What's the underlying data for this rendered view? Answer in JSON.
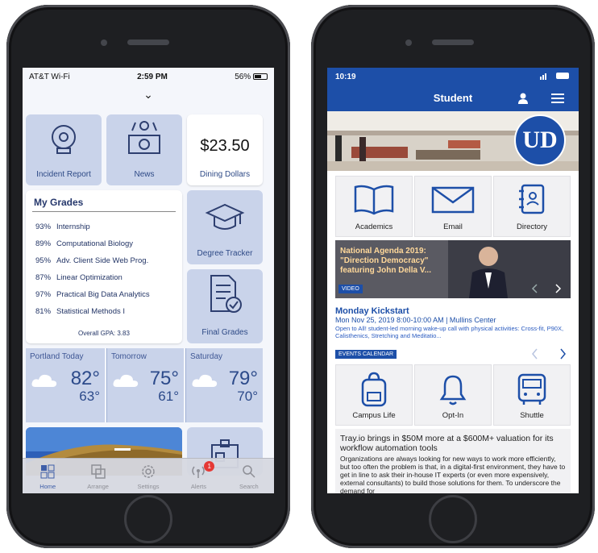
{
  "left_phone": {
    "status": {
      "carrier": "AT&T Wi-Fi",
      "time": "2:59 PM",
      "battery": "56%"
    },
    "pull_indicator": "⌄",
    "tiles": {
      "incident_report": "Incident Report",
      "news": "News",
      "dining_amount": "$23.50",
      "dining_label": "Dining Dollars",
      "degree_tracker": "Degree Tracker",
      "final_grades": "Final Grades"
    },
    "grades": {
      "title": "My Grades",
      "rows": [
        {
          "pct": "93%",
          "course": "Internship"
        },
        {
          "pct": "89%",
          "course": "Computational Biology"
        },
        {
          "pct": "95%",
          "course": "Adv. Client Side Web Prog."
        },
        {
          "pct": "87%",
          "course": "Linear Optimization"
        },
        {
          "pct": "97%",
          "course": "Practical Big Data Analytics"
        },
        {
          "pct": "81%",
          "course": "Statistical Methods I"
        }
      ],
      "gpa": "Overall GPA: 3.83"
    },
    "weather": [
      {
        "day": "Portland Today",
        "hi": "82°",
        "lo": "63°"
      },
      {
        "day": "Tomorrow",
        "hi": "75°",
        "lo": "61°"
      },
      {
        "day": "Saturday",
        "hi": "79°",
        "lo": "70°"
      }
    ],
    "tabbar": {
      "home": "Home",
      "arrange": "Arrange",
      "settings": "Settings",
      "alerts": "Alerts",
      "alerts_badge": "1",
      "search": "Search"
    },
    "colors": {
      "tile": "#c9d3ea",
      "accent": "#2e4a86"
    }
  },
  "right_phone": {
    "status": {
      "time": "10:19"
    },
    "nav_title": "Student",
    "logo_text": "UD",
    "tiles": [
      {
        "label": "Academics",
        "icon": "book-icon"
      },
      {
        "label": "Email",
        "icon": "envelope-icon"
      },
      {
        "label": "Directory",
        "icon": "address-book-icon"
      },
      {
        "label": "Campus Life",
        "icon": "backpack-icon"
      },
      {
        "label": "Opt-In",
        "icon": "bell-icon"
      },
      {
        "label": "Shuttle",
        "icon": "bus-icon"
      }
    ],
    "video": {
      "title": "National Agenda 2019: \"Direction Democracy\" featuring John Della V...",
      "tag": "VIDEO"
    },
    "event": {
      "title": "Monday Kickstart",
      "when": "Mon Nov 25, 2019 8:00-10:00 AM  | Mullins Center",
      "desc": "Open to All! student-led morning wake-up call with physical activities: Cross-fit, P90X, Calisthenics, Stretching and Meditatio...",
      "tag": "EVENTS CALENDAR"
    },
    "news": {
      "headline": "Tray.io brings in $50M more at a $600M+ valuation for its workflow automation tools",
      "body": "Organizations are always looking for new ways to work more efficiently, but too often the problem is that, in a digital-first environment, they have to get in line to ask their in-house IT experts (or even more expensively, external consultants) to build those solutions for them. To underscore the demand for"
    },
    "colors": {
      "brand": "#1d4fa8"
    }
  }
}
